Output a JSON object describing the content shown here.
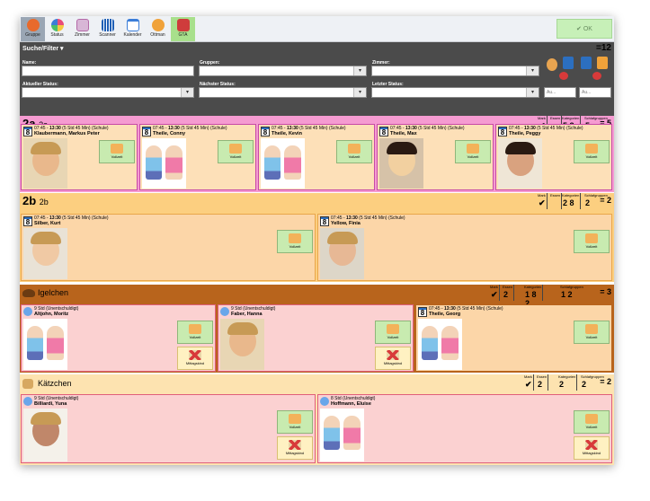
{
  "toolbar": {
    "buttons": [
      {
        "label": "Gruppe",
        "icon": "group-icon",
        "color": "#e86a2c"
      },
      {
        "label": "Status",
        "icon": "status-icon",
        "color": "#e84c7a"
      },
      {
        "label": "Zimmer",
        "icon": "room-icon",
        "color": "#b46aa8"
      },
      {
        "label": "Scanner",
        "icon": "scanner-icon",
        "color": "#1f5fb5"
      },
      {
        "label": "Kalender",
        "icon": "calendar-icon",
        "color": "#3b7dd8"
      },
      {
        "label": "Ottman",
        "icon": "ottman-icon",
        "color": "#f0a23a"
      },
      {
        "label": "GTA",
        "icon": "gta-icon",
        "color": "#cf3c3c"
      }
    ],
    "ok_label": "✔ OK"
  },
  "filter": {
    "title": "Suche/Filter ▾",
    "count": "=12",
    "name_label": "Name:",
    "gruppen_label": "Gruppen:",
    "zimmer_label": "Zimmer:",
    "aktueller_status_label": "Aktueller Status:",
    "naechster_status_label": "Nächster Status:",
    "letzter_status_label": "Letzter Status:",
    "au1": "Au...",
    "au2": "Au..."
  },
  "groups": [
    {
      "name": "2a",
      "sub": "2a",
      "color": "#f59bd1",
      "cols": [
        {
          "label": "Mark",
          "value": "✔"
        },
        {
          "label": "Essen",
          "value": ""
        },
        {
          "label": "Kategorien",
          "value": "5 8"
        },
        {
          "label": "Schlafgruppen",
          "value": "5"
        }
      ],
      "total": "= 5"
    },
    {
      "name": "2b",
      "sub": "2b",
      "color": "#fccf80",
      "cols": [
        {
          "label": "Mark",
          "value": "✔"
        },
        {
          "label": "Essen",
          "value": ""
        },
        {
          "label": "Kategorien",
          "value": "2 8"
        },
        {
          "label": "Schlafgruppen",
          "value": "2"
        }
      ],
      "total": "= 2"
    },
    {
      "name": "Igelchen",
      "sub": "",
      "color": "#b8641c",
      "cols": [
        {
          "label": "Mark",
          "value": "✔"
        },
        {
          "label": "Essen",
          "value": "2"
        },
        {
          "label": "Kategorien",
          "value": "1 8 2"
        },
        {
          "label": "Schlafgruppen",
          "value": "1 2"
        }
      ],
      "total": "= 3"
    },
    {
      "name": "Kätzchen",
      "sub": "",
      "color": "#fde3b0",
      "cols": [
        {
          "label": "Mark",
          "value": "✔"
        },
        {
          "label": "Essen",
          "value": "2"
        },
        {
          "label": "Kategorien",
          "value": "2"
        },
        {
          "label": "Schlafgruppen",
          "value": "2"
        }
      ],
      "total": "= 2"
    }
  ],
  "children": [
    {
      "time_pre": "07:45 - ",
      "time_bold": "13:30",
      "time_post": " (5 Std 45 Min) (Schule)",
      "name": "Klaubermann, Markus Peter",
      "btn1": "Vollzeit",
      "btn2": "",
      "badge": "8",
      "photo": "photo"
    },
    {
      "time_pre": "07:45 - ",
      "time_bold": "13:30",
      "time_post": " (5 Std 45 Min) (Schule)",
      "name": "Theile, Conny",
      "btn1": "Vollzeit",
      "btn2": "",
      "badge": "8",
      "photo": "kids"
    },
    {
      "time_pre": "07:45 - ",
      "time_bold": "13:30",
      "time_post": " (5 Std 45 Min) (Schule)",
      "name": "Theile, Kevin",
      "btn1": "Vollzeit",
      "btn2": "",
      "badge": "8",
      "photo": "kids"
    },
    {
      "time_pre": "07:45 - ",
      "time_bold": "13:30",
      "time_post": " (5 Std 45 Min) (Schule)",
      "name": "Theile, Max",
      "btn1": "Vollzeit",
      "btn2": "",
      "badge": "8",
      "photo": "photo"
    },
    {
      "time_pre": "07:45 - ",
      "time_bold": "13:30",
      "time_post": " (5 Std 45 Min) (Schule)",
      "name": "Theile, Peggy",
      "btn1": "Vollzeit",
      "btn2": "",
      "badge": "8",
      "photo": "photo"
    },
    {
      "time_pre": "07:45 - ",
      "time_bold": "13:30",
      "time_post": " (5 Std 45 Min) (Schule)",
      "name": "Silber, Kurt",
      "btn1": "Vollzeit",
      "btn2": "",
      "badge": "8",
      "photo": "photo"
    },
    {
      "time_pre": "07:45 - ",
      "time_bold": "13:30",
      "time_post": " (5 Std 45 Min) (Schule)",
      "name": "Yellow, Finia",
      "btn1": "Vollzeit",
      "btn2": "",
      "badge": "8",
      "photo": "photo"
    },
    {
      "time_pre": "9 Std (Unentschuldigt)",
      "time_bold": "",
      "time_post": "",
      "name": "Altjohn, Moritz",
      "btn1": "Vollzeit",
      "btn2": "Mittagskind",
      "badge": "",
      "photo": "kids"
    },
    {
      "time_pre": "9 Std (Unentschuldigt)",
      "time_bold": "",
      "time_post": "",
      "name": "Faber, Hanna",
      "btn1": "Vollzeit",
      "btn2": "Mittagskind",
      "badge": "",
      "photo": "photo"
    },
    {
      "time_pre": "07:45 - ",
      "time_bold": "13:30",
      "time_post": " (5 Std 45 Min) (Schule)",
      "name": "Theile, Georg",
      "btn1": "Vollzeit",
      "btn2": "",
      "badge": "8",
      "photo": "kids"
    },
    {
      "time_pre": "9 Std (Unentschuldigt)",
      "time_bold": "",
      "time_post": "",
      "name": "Billiardi, Yuna",
      "btn1": "Vollzeit",
      "btn2": "Mittagskind",
      "badge": "",
      "photo": "photo"
    },
    {
      "time_pre": "8 Std (Unentschuldigt)",
      "time_bold": "",
      "time_post": "",
      "name": "Hoffmann, Eluise",
      "btn1": "Vollzeit",
      "btn2": "Mittagskind",
      "badge": "",
      "photo": "kids"
    }
  ]
}
